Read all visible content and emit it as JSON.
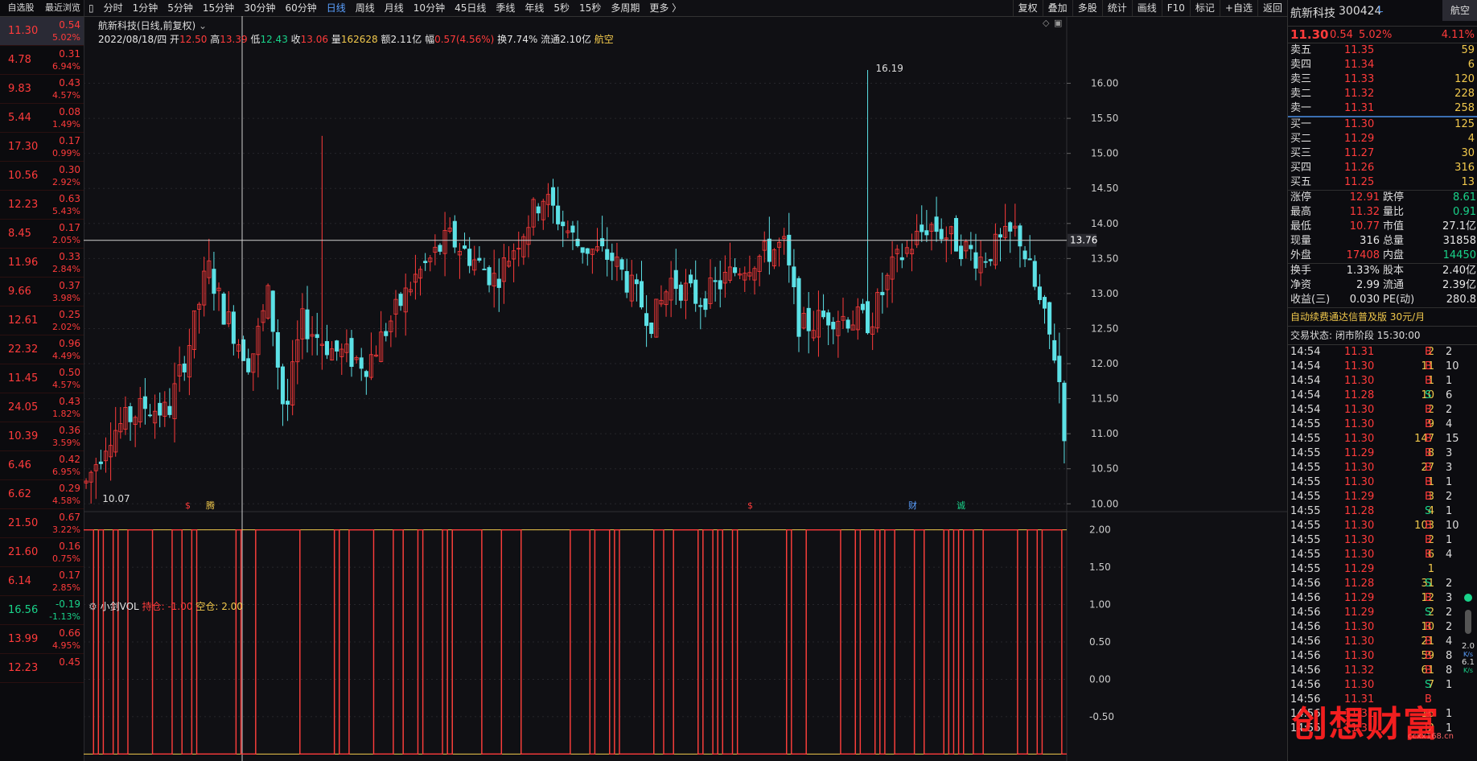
{
  "watchlist": {
    "tabs": [
      "自选股",
      "最近浏览"
    ],
    "rows": [
      {
        "price": "11.30",
        "chg": "0.54",
        "pct": "5.02%",
        "dir": "up"
      },
      {
        "price": "4.78",
        "chg": "0.31",
        "pct": "6.94%",
        "dir": "up"
      },
      {
        "price": "9.83",
        "chg": "0.43",
        "pct": "4.57%",
        "dir": "up"
      },
      {
        "price": "5.44",
        "chg": "0.08",
        "pct": "1.49%",
        "dir": "up"
      },
      {
        "price": "17.30",
        "chg": "0.17",
        "pct": "0.99%",
        "dir": "up"
      },
      {
        "price": "10.56",
        "chg": "0.30",
        "pct": "2.92%",
        "dir": "up"
      },
      {
        "price": "12.23",
        "chg": "0.63",
        "pct": "5.43%",
        "dir": "up"
      },
      {
        "price": "8.45",
        "chg": "0.17",
        "pct": "2.05%",
        "dir": "up"
      },
      {
        "price": "11.96",
        "chg": "0.33",
        "pct": "2.84%",
        "dir": "up"
      },
      {
        "price": "9.66",
        "chg": "0.37",
        "pct": "3.98%",
        "dir": "up"
      },
      {
        "price": "12.61",
        "chg": "0.25",
        "pct": "2.02%",
        "dir": "up"
      },
      {
        "price": "22.32",
        "chg": "0.96",
        "pct": "4.49%",
        "dir": "up"
      },
      {
        "price": "11.45",
        "chg": "0.50",
        "pct": "4.57%",
        "dir": "up"
      },
      {
        "price": "24.05",
        "chg": "0.43",
        "pct": "1.82%",
        "dir": "up"
      },
      {
        "price": "10.39",
        "chg": "0.36",
        "pct": "3.59%",
        "dir": "up"
      },
      {
        "price": "6.46",
        "chg": "0.42",
        "pct": "6.95%",
        "dir": "up"
      },
      {
        "price": "6.62",
        "chg": "0.29",
        "pct": "4.58%",
        "dir": "up"
      },
      {
        "price": "21.50",
        "chg": "0.67",
        "pct": "3.22%",
        "dir": "up"
      },
      {
        "price": "21.60",
        "chg": "0.16",
        "pct": "0.75%",
        "dir": "up"
      },
      {
        "price": "6.14",
        "chg": "0.17",
        "pct": "2.85%",
        "dir": "up"
      },
      {
        "price": "16.56",
        "chg": "-0.19",
        "pct": "-1.13%",
        "dir": "dn"
      },
      {
        "price": "13.99",
        "chg": "0.66",
        "pct": "4.95%",
        "dir": "up"
      },
      {
        "price": "12.23",
        "chg": "0.45",
        "pct": "",
        "dir": "up"
      }
    ]
  },
  "toolbar": {
    "periods": [
      "分时",
      "1分钟",
      "5分钟",
      "15分钟",
      "30分钟",
      "60分钟",
      "日线",
      "周线",
      "月线",
      "10分钟",
      "45日线",
      "季线",
      "年线",
      "5秒",
      "15秒",
      "多周期",
      "更多 〉"
    ],
    "active": "日线",
    "right": [
      "复权",
      "叠加",
      "多股",
      "统计",
      "画线",
      "F10",
      "+自选",
      "返回"
    ],
    "right_extra": "标记"
  },
  "chart_header": {
    "title": "航新科技(日线,前复权)",
    "date": "2022/08/18/四",
    "open_label": "开",
    "open": "12.50",
    "high_label": "高",
    "high": "13.39",
    "low_label": "低",
    "low": "12.43",
    "close_label": "收",
    "close": "13.06",
    "vol_label": "量",
    "vol": "162628",
    "amt_label": "额",
    "amt": "2.11亿",
    "amp_label": "幅",
    "amp": "0.57(4.56%)",
    "turn_label": "换",
    "turn": "7.74%",
    "float_label": "流通",
    "float": "2.10亿",
    "sector": "航空"
  },
  "chart_data": {
    "type": "candlestick",
    "y_ticks": [
      "16.00",
      "15.50",
      "15.00",
      "14.50",
      "14.00",
      "13.50",
      "13.00",
      "12.50",
      "12.00",
      "11.50",
      "11.00",
      "10.50",
      "10.00"
    ],
    "ylim": [
      9.9,
      16.5
    ],
    "crosshair_value": "13.76",
    "max_label": "16.19",
    "min_label": "10.07",
    "markers": [
      "$",
      "腾",
      "$",
      "财",
      "诚"
    ],
    "indicator": {
      "name": "小剑VOL",
      "long_label": "持仓:",
      "long_value": "-1.00",
      "short_label": "空仓:",
      "short_value": "2.00",
      "y_ticks": [
        "2.00",
        "1.50",
        "1.00",
        "0.50",
        "0.00",
        "-0.50"
      ],
      "ylim": [
        -1.05,
        2.05
      ]
    }
  },
  "quote": {
    "name": "航新科技",
    "code": "300424",
    "flag": "L",
    "sector_btn": "航空",
    "price": "11.30",
    "chg": "0.54",
    "pct": "5.02%",
    "sector_pct": "4.11%",
    "asks": [
      {
        "label": "卖五",
        "price": "11.35",
        "vol": "59"
      },
      {
        "label": "卖四",
        "price": "11.34",
        "vol": "6"
      },
      {
        "label": "卖三",
        "price": "11.33",
        "vol": "120"
      },
      {
        "label": "卖二",
        "price": "11.32",
        "vol": "228"
      },
      {
        "label": "卖一",
        "price": "11.31",
        "vol": "258"
      }
    ],
    "bids": [
      {
        "label": "买一",
        "price": "11.30",
        "vol": "125"
      },
      {
        "label": "买二",
        "price": "11.29",
        "vol": "4"
      },
      {
        "label": "买三",
        "price": "11.27",
        "vol": "30"
      },
      {
        "label": "买四",
        "price": "11.26",
        "vol": "316"
      },
      {
        "label": "买五",
        "price": "11.25",
        "vol": "13"
      }
    ],
    "stats": [
      [
        {
          "l": "涨停",
          "v": "12.91",
          "c": "up"
        },
        {
          "l": "跌停",
          "v": "8.61",
          "c": "dn"
        }
      ],
      [
        {
          "l": "最高",
          "v": "11.32",
          "c": "up"
        },
        {
          "l": "量比",
          "v": "0.91",
          "c": "dn"
        }
      ],
      [
        {
          "l": "最低",
          "v": "10.77",
          "c": "up"
        },
        {
          "l": "市值",
          "v": "27.1亿",
          "c": "wh"
        }
      ],
      [
        {
          "l": "现量",
          "v": "316",
          "c": "wh"
        },
        {
          "l": "总量",
          "v": "31858",
          "c": "wh"
        }
      ],
      [
        {
          "l": "外盘",
          "v": "17408",
          "c": "up"
        },
        {
          "l": "内盘",
          "v": "14450",
          "c": "dn"
        }
      ]
    ],
    "stats2": [
      [
        {
          "l": "换手",
          "v": "1.33%",
          "c": "wh"
        },
        {
          "l": "股本",
          "v": "2.40亿",
          "c": "wh"
        }
      ],
      [
        {
          "l": "净资",
          "v": "2.99",
          "c": "wh"
        },
        {
          "l": "流通",
          "v": "2.39亿",
          "c": "wh"
        }
      ],
      [
        {
          "l": "收益(三)",
          "v": "0.030",
          "c": "wh"
        },
        {
          "l": "PE(动)",
          "v": "280.8",
          "c": "wh"
        }
      ]
    ],
    "ad": "自动续费通达信普及版  30元/月",
    "state": "交易状态: 闭市阶段 15:30:00",
    "ticks": [
      {
        "t": "14:54",
        "p": "11.31",
        "v": "2",
        "s": "B",
        "n": "2"
      },
      {
        "t": "14:54",
        "p": "11.30",
        "v": "11",
        "s": "B",
        "n": "10"
      },
      {
        "t": "14:54",
        "p": "11.30",
        "v": "1",
        "s": "B",
        "n": "1"
      },
      {
        "t": "14:54",
        "p": "11.28",
        "v": "10",
        "s": "S",
        "n": "6"
      },
      {
        "t": "14:54",
        "p": "11.30",
        "v": "2",
        "s": "B",
        "n": "2"
      },
      {
        "t": "14:55",
        "p": "11.30",
        "v": "9",
        "s": "B",
        "n": "4"
      },
      {
        "t": "14:55",
        "p": "11.30",
        "v": "147",
        "s": "B",
        "n": "15"
      },
      {
        "t": "14:55",
        "p": "11.29",
        "v": "8",
        "s": "B",
        "n": "3"
      },
      {
        "t": "14:55",
        "p": "11.30",
        "v": "27",
        "s": "B",
        "n": "3"
      },
      {
        "t": "14:55",
        "p": "11.30",
        "v": "1",
        "s": "B",
        "n": "1"
      },
      {
        "t": "14:55",
        "p": "11.29",
        "v": "3",
        "s": "B",
        "n": "2"
      },
      {
        "t": "14:55",
        "p": "11.28",
        "v": "4",
        "s": "S",
        "n": "1"
      },
      {
        "t": "14:55",
        "p": "11.30",
        "v": "103",
        "s": "B",
        "n": "10"
      },
      {
        "t": "14:55",
        "p": "11.30",
        "v": "2",
        "s": "B",
        "n": "1"
      },
      {
        "t": "14:55",
        "p": "11.30",
        "v": "6",
        "s": "B",
        "n": "4"
      },
      {
        "t": "14:55",
        "p": "11.29",
        "v": "1",
        "s": "",
        "n": ""
      },
      {
        "t": "14:56",
        "p": "11.28",
        "v": "31",
        "s": "S",
        "n": "2"
      },
      {
        "t": "14:56",
        "p": "11.29",
        "v": "12",
        "s": "B",
        "n": "3"
      },
      {
        "t": "14:56",
        "p": "11.29",
        "v": "2",
        "s": "S",
        "n": "2"
      },
      {
        "t": "14:56",
        "p": "11.30",
        "v": "10",
        "s": "B",
        "n": "2"
      },
      {
        "t": "14:56",
        "p": "11.30",
        "v": "21",
        "s": "B",
        "n": "4"
      },
      {
        "t": "14:56",
        "p": "11.30",
        "v": "59",
        "s": "B",
        "n": "8"
      },
      {
        "t": "14:56",
        "p": "11.32",
        "v": "61",
        "s": "B",
        "n": "8"
      },
      {
        "t": "14:56",
        "p": "11.30",
        "v": "7",
        "s": "S",
        "n": "1"
      },
      {
        "t": "14:56",
        "p": "11.31",
        "v": "",
        "s": "B",
        "n": ""
      },
      {
        "t": "14:56",
        "p": "11.31",
        "v": "16",
        "s": "B",
        "n": "1"
      },
      {
        "t": "14:56",
        "p": "11.31",
        "v": "2",
        "s": "B",
        "n": "1"
      }
    ],
    "speed": [
      "2.0",
      "6.1"
    ],
    "speed_unit": "K/s"
  },
  "watermark": {
    "text": "创想财富",
    "url": "ccxx168.cn"
  }
}
